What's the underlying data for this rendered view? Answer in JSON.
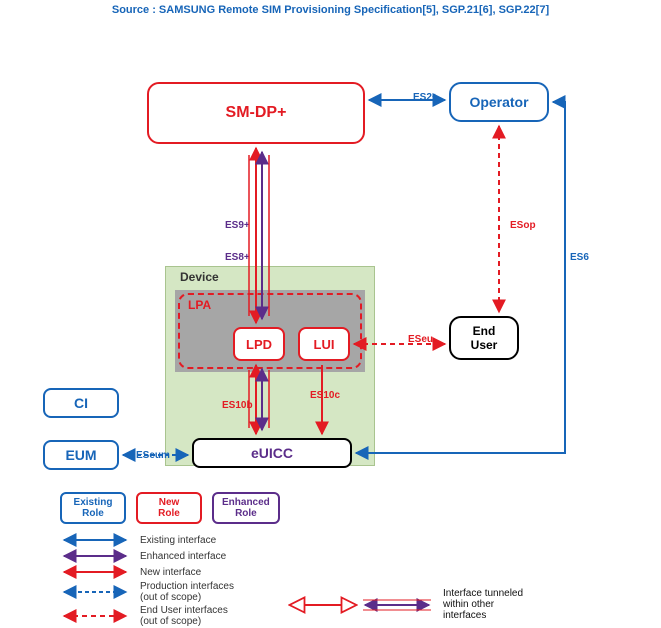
{
  "source_line": "Source : SAMSUNG Remote SIM Provisioning Specification[5], SGP.21[6], SGP.22[7]",
  "nodes": {
    "smdp": {
      "label": "SM-DP+"
    },
    "operator": {
      "label": "Operator"
    },
    "enduser": {
      "label": "End\nUser"
    },
    "lpd": {
      "label": "LPD"
    },
    "lui": {
      "label": "LUI"
    },
    "euicc": {
      "label": "eUICC"
    },
    "ci": {
      "label": "CI"
    },
    "eum": {
      "label": "EUM"
    }
  },
  "containers": {
    "device": {
      "label": "Device"
    },
    "lpa": {
      "label": "LPA"
    }
  },
  "edges": {
    "es2plus": "ES2+",
    "es9plus": "ES9+",
    "es8plus": "ES8+",
    "esop": "ESop",
    "es6": "ES6",
    "eseu": "ESeu",
    "es10b": "ES10b",
    "es10c": "ES10c",
    "eseum": "ESeum"
  },
  "legend": {
    "roles": {
      "existing": "Existing\nRole",
      "new": "New\nRole",
      "enhanced": "Enhanced\nRole"
    },
    "items": {
      "existing_if": "Existing interface",
      "enhanced_if": "Enhanced interface",
      "new_if": "New interface",
      "prod_if": "Production interfaces\n(out of scope)",
      "enduser_if": "End User interfaces\n(out of scope)",
      "tunneled_if": "Interface tunneled\nwithin other\ninterfaces"
    }
  }
}
